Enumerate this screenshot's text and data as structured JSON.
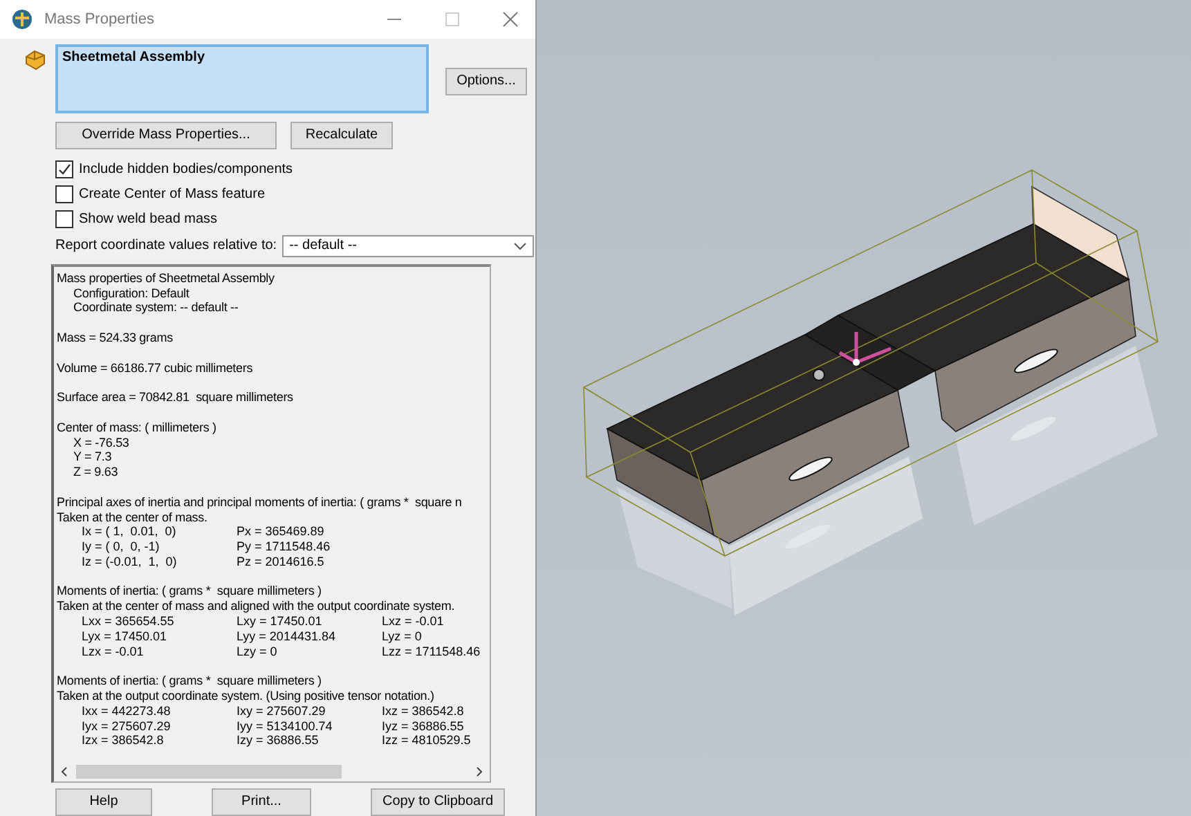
{
  "window": {
    "title": "Mass Properties"
  },
  "selection": {
    "items": [
      "Sheetmetal Assembly"
    ]
  },
  "options_button": "Options...",
  "action_buttons": [
    "Override Mass Properties...",
    "Recalculate"
  ],
  "checkboxes": [
    {
      "label": "Include hidden bodies/components",
      "checked": true
    },
    {
      "label": "Create Center of Mass feature",
      "checked": false
    },
    {
      "label": "Show weld bead mass",
      "checked": false
    }
  ],
  "coordinate_select": {
    "label": "Report coordinate values relative to:",
    "value": "-- default --"
  },
  "results": {
    "lines": [
      {
        "kind": "text",
        "text": "Mass properties of Sheetmetal Assembly"
      },
      {
        "kind": "sub",
        "text": "Configuration: Default"
      },
      {
        "kind": "sub",
        "text": "Coordinate system: -- default --"
      },
      {
        "kind": "gap"
      },
      {
        "kind": "text",
        "text": "Mass = 524.33 grams"
      },
      {
        "kind": "gap"
      },
      {
        "kind": "text",
        "text": "Volume = 66186.77 cubic millimeters"
      },
      {
        "kind": "gap"
      },
      {
        "kind": "text",
        "text": "Surface area = 70842.81  square millimeters"
      },
      {
        "kind": "gap"
      },
      {
        "kind": "text",
        "text": "Center of mass: ( millimeters )"
      },
      {
        "kind": "sub",
        "text": "X = -76.53"
      },
      {
        "kind": "sub",
        "text": "Y = 7.3"
      },
      {
        "kind": "sub",
        "text": "Z = 9.63"
      },
      {
        "kind": "gap"
      },
      {
        "kind": "text",
        "text": "Principal axes of inertia and principal moments of inertia: ( grams *  square n"
      },
      {
        "kind": "text",
        "text": "Taken at the center of mass."
      },
      {
        "kind": "row",
        "cells": [
          "Ix = ( 1,  0.01,  0)",
          "Px = 365469.89"
        ]
      },
      {
        "kind": "row",
        "cells": [
          "Iy = ( 0,  0, -1)",
          "Py = 1711548.46"
        ]
      },
      {
        "kind": "row",
        "cells": [
          "Iz = (-0.01,  1,  0)",
          "Pz = 2014616.5"
        ]
      },
      {
        "kind": "gap"
      },
      {
        "kind": "text",
        "text": "Moments of inertia: ( grams *  square millimeters )"
      },
      {
        "kind": "text",
        "text": "Taken at the center of mass and aligned with the output coordinate system."
      },
      {
        "kind": "row",
        "cells": [
          "Lxx = 365654.55",
          "Lxy = 17450.01",
          "Lxz = -0.01"
        ]
      },
      {
        "kind": "row",
        "cells": [
          "Lyx = 17450.01",
          "Lyy = 2014431.84",
          "Lyz = 0"
        ]
      },
      {
        "kind": "row",
        "cells": [
          "Lzx = -0.01",
          "Lzy = 0",
          "Lzz = 1711548.46"
        ]
      },
      {
        "kind": "gap"
      },
      {
        "kind": "text",
        "text": "Moments of inertia: ( grams *  square millimeters )"
      },
      {
        "kind": "text",
        "text": "Taken at the output coordinate system. (Using positive tensor notation.)"
      },
      {
        "kind": "row",
        "cells": [
          "Ixx = 442273.48",
          "Ixy = 275607.29",
          "Ixz = 386542.8"
        ]
      },
      {
        "kind": "row",
        "cells": [
          "Iyx = 275607.29",
          "Iyy = 5134100.74",
          "Iyz = 36886.55"
        ]
      },
      {
        "kind": "row",
        "cells": [
          "Izx = 386542.8",
          "Izy = 36886.55",
          "Izz = 4810529.5"
        ]
      }
    ]
  },
  "bottom_buttons": [
    "Help",
    "Print...",
    "Copy to Clipboard"
  ]
}
